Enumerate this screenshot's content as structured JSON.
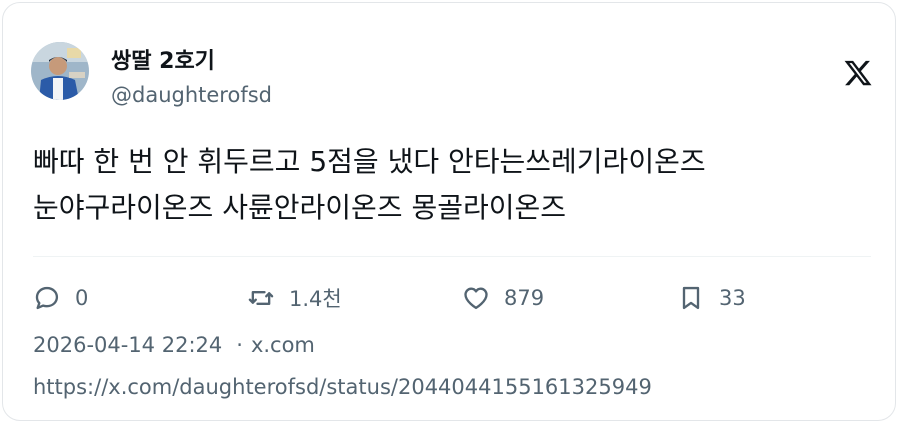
{
  "author": {
    "display_name": "쌍딸 2호기",
    "handle": "@daughterofsd"
  },
  "logo": {
    "icon": "x-logo-icon"
  },
  "tweet": {
    "text": "빠따 한 번 안 휘두르고 5점을 냈다 안타는쓰레기라이온즈\n눈야구라이온즈 사륜안라이온즈 몽골라이온즈"
  },
  "actions": {
    "reply": {
      "icon": "reply-icon",
      "count": "0"
    },
    "retweet": {
      "icon": "retweet-icon",
      "count": "1.4천"
    },
    "like": {
      "icon": "heart-icon",
      "count": "879"
    },
    "bookmark": {
      "icon": "bookmark-icon",
      "count": "33"
    }
  },
  "meta": {
    "timestamp": "2026-04-14 22:24",
    "separator": "·",
    "source": "x.com"
  },
  "url": "https://x.com/daughterofsd/status/2044044155161325949",
  "colors": {
    "text_primary": "#0f1419",
    "text_secondary": "#536471",
    "border": "#e3e6e9"
  }
}
